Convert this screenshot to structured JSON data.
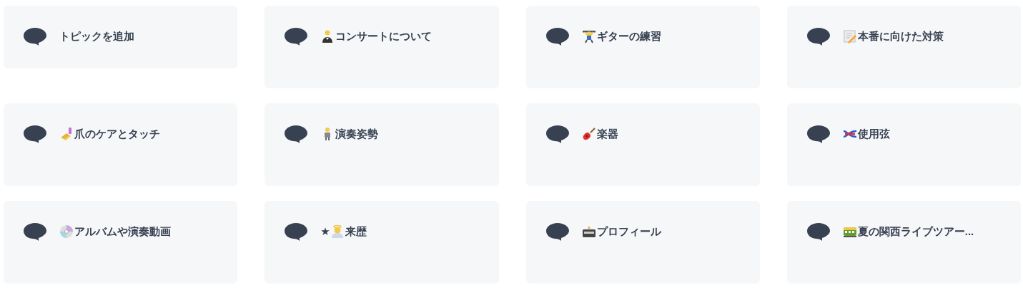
{
  "topics": [
    {
      "kind": "add",
      "title": "トピックを追加"
    },
    {
      "kind": "topic",
      "title": "コンサートについて"
    },
    {
      "kind": "topic",
      "title": "ギターの練習"
    },
    {
      "kind": "topic",
      "title": "本番に向けた対策"
    },
    {
      "kind": "topic",
      "title": "爪のケアとタッチ"
    },
    {
      "kind": "topic",
      "title": "演奏姿勢"
    },
    {
      "kind": "topic",
      "title": "楽器"
    },
    {
      "kind": "topic",
      "title": "使用弦"
    },
    {
      "kind": "topic",
      "title": "アルバムや演奏動画"
    },
    {
      "kind": "topic",
      "prefix": "★",
      "title": "来歴"
    },
    {
      "kind": "topic",
      "title": "プロフィール"
    },
    {
      "kind": "topic",
      "title": "夏の関西ライブツアー..."
    }
  ]
}
